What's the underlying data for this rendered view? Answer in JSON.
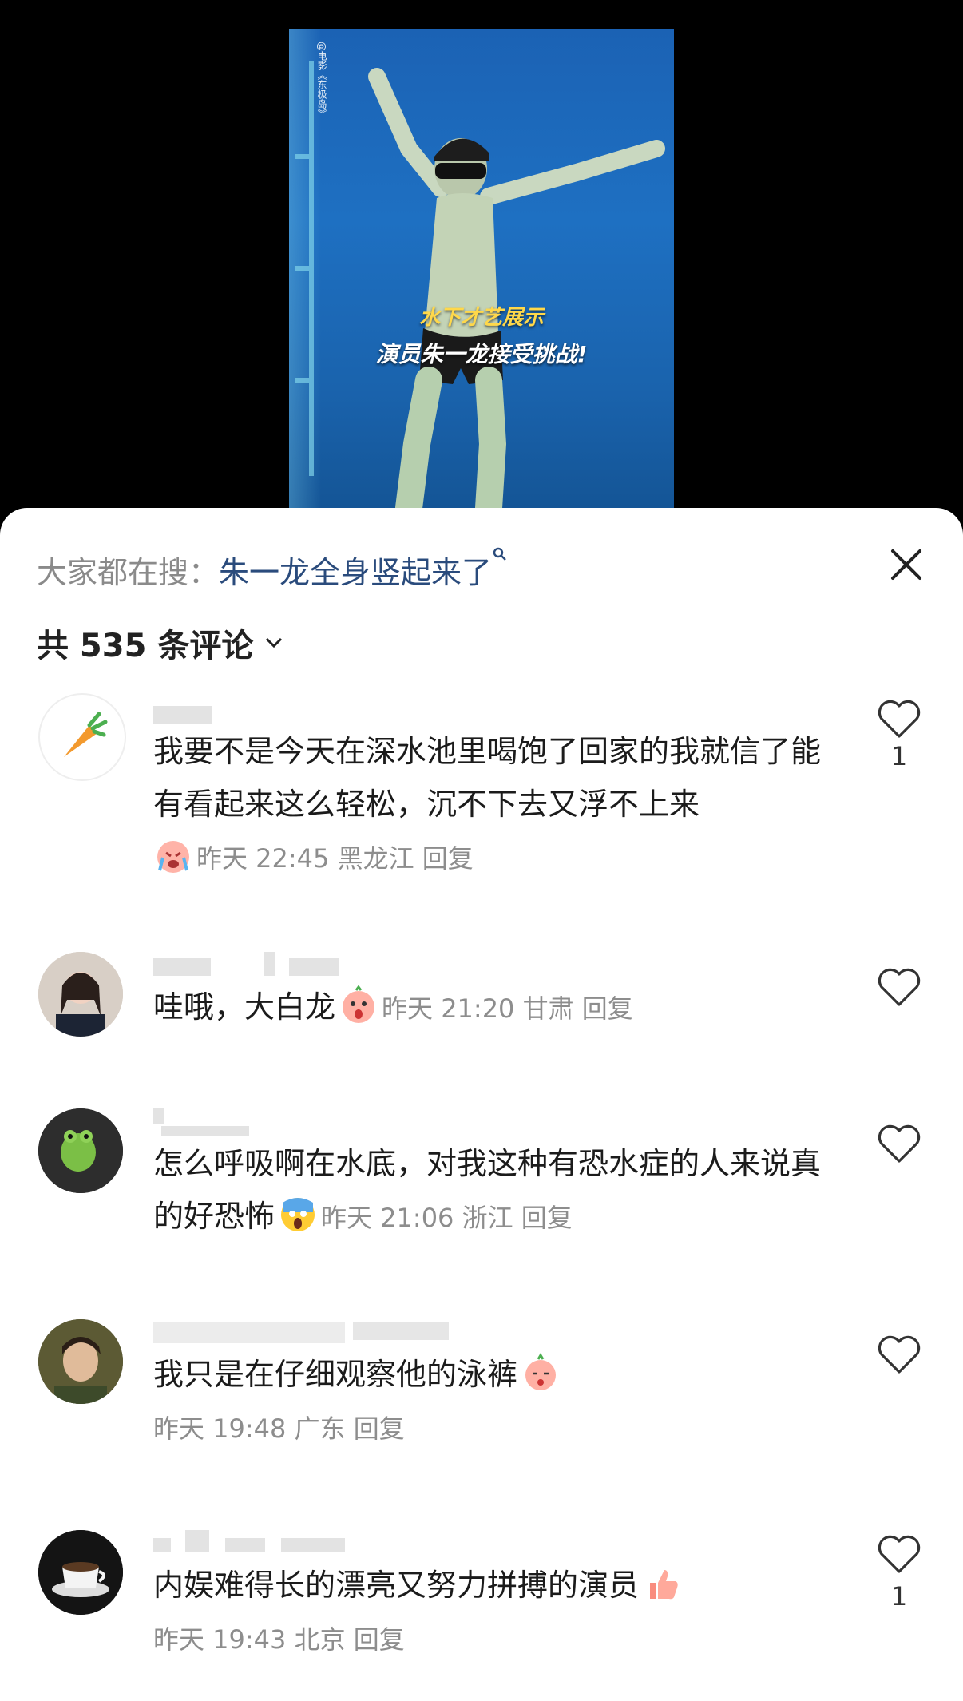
{
  "video": {
    "watermark": "@电影《东极岛》",
    "caption_line1": "水下才艺展示",
    "caption_line2": "演员朱一龙接受挑战!"
  },
  "search": {
    "label": "大家都在搜：",
    "keyword": "朱一龙全身竖起来了"
  },
  "comments_header": {
    "count_text": "共 535 条评论"
  },
  "comments": [
    {
      "text": "我要不是今天在深水池里喝饱了回家的我就信了能有看起来这么轻松，沉不下去又浮不上来",
      "emoji": "crying-emoji",
      "time": "昨天 22:45",
      "location": "黑龙江",
      "reply": "回复",
      "likes": "1"
    },
    {
      "text": "哇哦，大白龙",
      "emoji": "shocked-pink-emoji",
      "time": "昨天 21:20",
      "location": "甘肃",
      "reply": "回复",
      "likes": ""
    },
    {
      "text": "怎么呼吸啊在水底，对我这种有恐水症的人来说真的好恐怖",
      "emoji": "screaming-emoji",
      "time": "昨天 21:06",
      "location": "浙江",
      "reply": "回复",
      "likes": ""
    },
    {
      "text": "我只是在仔细观察他的泳裤",
      "emoji": "shy-peach-emoji",
      "time": "昨天 19:48",
      "location": "广东",
      "reply": "回复",
      "likes": ""
    },
    {
      "text": "内娱难得长的漂亮又努力拼搏的演员",
      "emoji": "thumbs-up-emoji",
      "time": "昨天 19:43",
      "location": "北京",
      "reply": "回复",
      "likes": "1"
    }
  ],
  "colors": {
    "keyword": "#2a4b7c",
    "meta": "#8d8d8d",
    "caption_yellow": "#ffd84a"
  }
}
